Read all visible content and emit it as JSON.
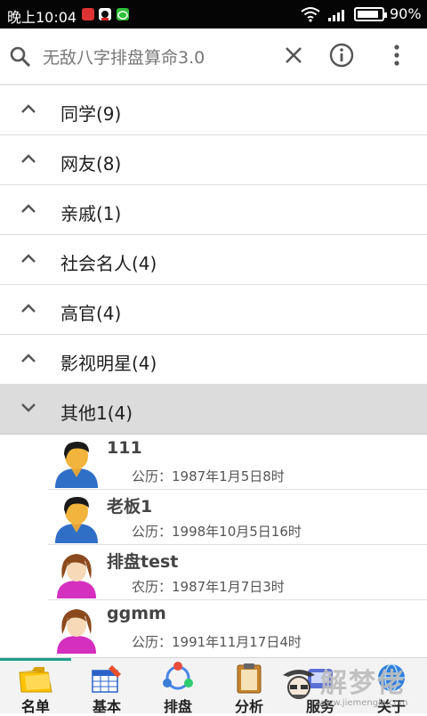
{
  "status_bar": {
    "time": "晚上10:04",
    "battery_percent": "90%",
    "battery_level": 0.9,
    "notification_icons": [
      "alert-icon",
      "qq-icon",
      "wechat-icon"
    ],
    "system_icons": [
      "wifi-icon",
      "signal-icon",
      "battery-icon"
    ]
  },
  "search_bar": {
    "placeholder": "无敌八字排盘算命3.0",
    "icons": [
      "search-icon",
      "clear-icon",
      "info-icon",
      "overflow-menu-icon"
    ]
  },
  "groups": [
    {
      "label": "同学(9)",
      "expanded": false
    },
    {
      "label": "网友(8)",
      "expanded": false
    },
    {
      "label": "亲戚(1)",
      "expanded": false
    },
    {
      "label": "社会名人(4)",
      "expanded": false
    },
    {
      "label": "高官(4)",
      "expanded": false
    },
    {
      "label": "影视明星(4)",
      "expanded": false
    },
    {
      "label": "其他1(4)",
      "expanded": true
    }
  ],
  "contacts": [
    {
      "name": "111",
      "date": "公历：1987年1月5日8时",
      "avatar": "male-avatar-icon"
    },
    {
      "name": "老板1",
      "date": "公历：1998年10月5日16时",
      "avatar": "male-avatar-icon"
    },
    {
      "name": "排盘test",
      "date": "农历：1987年1月7日3时",
      "avatar": "female-avatar-icon"
    },
    {
      "name": "ggmm",
      "date": "公历：1991年11月17日4时",
      "avatar": "female-avatar-icon"
    }
  ],
  "tabs": [
    {
      "label": "名单",
      "icon": "folder-icon",
      "active": true
    },
    {
      "label": "基本",
      "icon": "grid-pencil-icon",
      "active": false
    },
    {
      "label": "排盘",
      "icon": "cycle-icon",
      "active": false
    },
    {
      "label": "分析",
      "icon": "clipboard-icon",
      "active": false
    },
    {
      "label": "服务",
      "icon": "service-icon",
      "active": false
    },
    {
      "label": "关于",
      "icon": "globe-icon",
      "active": false
    }
  ],
  "colors": {
    "accent": "#1e9e8a",
    "expanded_row": "#dcdcdc",
    "status_bar": "#050505"
  },
  "watermark": {
    "text": "解梦佬",
    "url": "www.jiemengla.com"
  }
}
